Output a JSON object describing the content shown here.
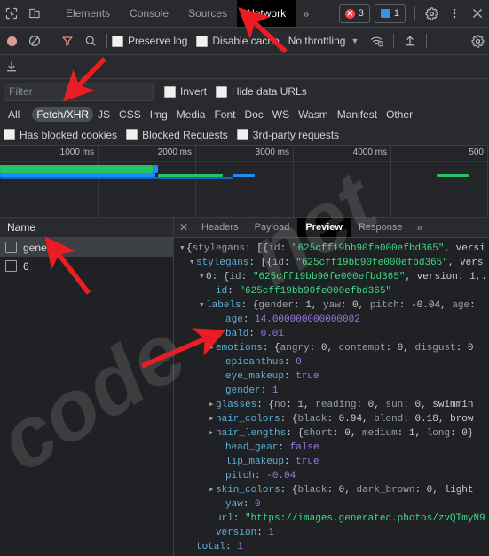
{
  "window": {
    "tabs": [
      {
        "label": "Elements",
        "active": false
      },
      {
        "label": "Console",
        "active": false
      },
      {
        "label": "Sources",
        "active": false
      },
      {
        "label": "Network",
        "active": true
      }
    ],
    "more_tabs_label": "»",
    "error_count": "3",
    "message_count": "1"
  },
  "toolbar": {
    "preserve_log": "Preserve log",
    "disable_cache": "Disable cache",
    "throttling": "No throttling",
    "throttle_caret": "▼"
  },
  "filter": {
    "placeholder": "Filter",
    "value": "",
    "invert": "Invert",
    "hide_data_urls": "Hide data URLs"
  },
  "types": [
    {
      "label": "All",
      "selected": false
    },
    {
      "label": "Fetch/XHR",
      "selected": true
    },
    {
      "label": "JS",
      "selected": false
    },
    {
      "label": "CSS",
      "selected": false
    },
    {
      "label": "Img",
      "selected": false
    },
    {
      "label": "Media",
      "selected": false
    },
    {
      "label": "Font",
      "selected": false
    },
    {
      "label": "Doc",
      "selected": false
    },
    {
      "label": "WS",
      "selected": false
    },
    {
      "label": "Wasm",
      "selected": false
    },
    {
      "label": "Manifest",
      "selected": false
    },
    {
      "label": "Other",
      "selected": false
    }
  ],
  "blocked": {
    "has_blocked_cookies": "Has blocked cookies",
    "blocked_requests": "Blocked Requests",
    "third_party": "3rd-party requests"
  },
  "overview": {
    "ticks": [
      "1000 ms",
      "2000 ms",
      "3000 ms",
      "4000 ms",
      "500"
    ],
    "colors": {
      "green": "#25c462",
      "blue": "#1a8cff",
      "darkblue": "#1565c0"
    }
  },
  "requests": {
    "column_header": "Name",
    "rows": [
      {
        "name": "generate",
        "selected": true
      },
      {
        "name": "6",
        "selected": false
      }
    ]
  },
  "detail": {
    "tabs": [
      {
        "label": "Headers",
        "active": false
      },
      {
        "label": "Payload",
        "active": false
      },
      {
        "label": "Preview",
        "active": true
      },
      {
        "label": "Response",
        "active": false
      }
    ],
    "more_label": "»",
    "close_label": "✕"
  },
  "preview": {
    "lines": [
      {
        "indent": 0,
        "arrow": "▾",
        "parts": [
          {
            "t": "{",
            "c": "p"
          },
          {
            "t": "stylegans",
            "c": "kd"
          },
          {
            "t": ": [{",
            "c": "p"
          },
          {
            "t": "id",
            "c": "kd"
          },
          {
            "t": ": ",
            "c": "p"
          },
          {
            "t": "\"625cff19bb90fe000efbd365\"",
            "c": "s"
          },
          {
            "t": ", versi",
            "c": "p"
          }
        ]
      },
      {
        "indent": 1,
        "arrow": "▾",
        "parts": [
          {
            "t": "stylegans",
            "c": "k"
          },
          {
            "t": ": [{",
            "c": "p"
          },
          {
            "t": "id",
            "c": "kd"
          },
          {
            "t": ": ",
            "c": "p"
          },
          {
            "t": "\"625cff19bb90fe000efbd365\"",
            "c": "s"
          },
          {
            "t": ", vers",
            "c": "p"
          }
        ]
      },
      {
        "indent": 2,
        "arrow": "▾",
        "parts": [
          {
            "t": "0",
            "c": "p"
          },
          {
            "t": ": {",
            "c": "p"
          },
          {
            "t": "id",
            "c": "kd"
          },
          {
            "t": ": ",
            "c": "p"
          },
          {
            "t": "\"625cff19bb90fe000efbd365\"",
            "c": "s"
          },
          {
            "t": ", version: 1,.",
            "c": "p"
          }
        ]
      },
      {
        "indent": 3,
        "arrow": "",
        "parts": [
          {
            "t": "id",
            "c": "k"
          },
          {
            "t": ": ",
            "c": "p"
          },
          {
            "t": "\"625cff19bb90fe000efbd365\"",
            "c": "s"
          }
        ]
      },
      {
        "indent": 2,
        "arrow": "▾",
        "parts": [
          {
            "t": "labels",
            "c": "k"
          },
          {
            "t": ": {",
            "c": "p"
          },
          {
            "t": "gender",
            "c": "kd"
          },
          {
            "t": ": 1, ",
            "c": "p"
          },
          {
            "t": "yaw",
            "c": "kd"
          },
          {
            "t": ": 0, ",
            "c": "p"
          },
          {
            "t": "pitch",
            "c": "kd"
          },
          {
            "t": ": -0.04, ",
            "c": "p"
          },
          {
            "t": "age",
            "c": "kd"
          },
          {
            "t": ":",
            "c": "p"
          }
        ]
      },
      {
        "indent": 4,
        "arrow": "",
        "parts": [
          {
            "t": "age",
            "c": "k"
          },
          {
            "t": ": ",
            "c": "p"
          },
          {
            "t": "14.000000000000002",
            "c": "n"
          }
        ]
      },
      {
        "indent": 4,
        "arrow": "",
        "parts": [
          {
            "t": "bald",
            "c": "k"
          },
          {
            "t": ": ",
            "c": "p"
          },
          {
            "t": "0.01",
            "c": "n"
          }
        ]
      },
      {
        "indent": 3,
        "arrow": "▸",
        "parts": [
          {
            "t": "emotions",
            "c": "k"
          },
          {
            "t": ": {",
            "c": "p"
          },
          {
            "t": "angry",
            "c": "kd"
          },
          {
            "t": ": 0, ",
            "c": "p"
          },
          {
            "t": "contempt",
            "c": "kd"
          },
          {
            "t": ": 0, ",
            "c": "p"
          },
          {
            "t": "disgust",
            "c": "kd"
          },
          {
            "t": ": 0",
            "c": "p"
          }
        ]
      },
      {
        "indent": 4,
        "arrow": "",
        "parts": [
          {
            "t": "epicanthus",
            "c": "k"
          },
          {
            "t": ": ",
            "c": "p"
          },
          {
            "t": "0",
            "c": "n"
          }
        ]
      },
      {
        "indent": 4,
        "arrow": "",
        "parts": [
          {
            "t": "eye_makeup",
            "c": "k"
          },
          {
            "t": ": ",
            "c": "p"
          },
          {
            "t": "true",
            "c": "b"
          }
        ]
      },
      {
        "indent": 4,
        "arrow": "",
        "parts": [
          {
            "t": "gender",
            "c": "k"
          },
          {
            "t": ": ",
            "c": "p"
          },
          {
            "t": "1",
            "c": "n"
          }
        ]
      },
      {
        "indent": 3,
        "arrow": "▸",
        "parts": [
          {
            "t": "glasses",
            "c": "k"
          },
          {
            "t": ": {",
            "c": "p"
          },
          {
            "t": "no",
            "c": "kd"
          },
          {
            "t": ": 1, ",
            "c": "p"
          },
          {
            "t": "reading",
            "c": "kd"
          },
          {
            "t": ": 0, ",
            "c": "p"
          },
          {
            "t": "sun",
            "c": "kd"
          },
          {
            "t": ": 0, swimmin",
            "c": "p"
          }
        ]
      },
      {
        "indent": 3,
        "arrow": "▸",
        "parts": [
          {
            "t": "hair_colors",
            "c": "k"
          },
          {
            "t": ": {",
            "c": "p"
          },
          {
            "t": "black",
            "c": "kd"
          },
          {
            "t": ": 0.94, ",
            "c": "p"
          },
          {
            "t": "blond",
            "c": "kd"
          },
          {
            "t": ": 0.18, brow",
            "c": "p"
          }
        ]
      },
      {
        "indent": 3,
        "arrow": "▸",
        "parts": [
          {
            "t": "hair_lengths",
            "c": "k"
          },
          {
            "t": ": {",
            "c": "p"
          },
          {
            "t": "short",
            "c": "kd"
          },
          {
            "t": ": 0, ",
            "c": "p"
          },
          {
            "t": "medium",
            "c": "kd"
          },
          {
            "t": ": 1, ",
            "c": "p"
          },
          {
            "t": "long",
            "c": "kd"
          },
          {
            "t": ": 0}",
            "c": "p"
          }
        ]
      },
      {
        "indent": 4,
        "arrow": "",
        "parts": [
          {
            "t": "head_gear",
            "c": "k"
          },
          {
            "t": ": ",
            "c": "p"
          },
          {
            "t": "false",
            "c": "b"
          }
        ]
      },
      {
        "indent": 4,
        "arrow": "",
        "parts": [
          {
            "t": "lip_makeup",
            "c": "k"
          },
          {
            "t": ": ",
            "c": "p"
          },
          {
            "t": "true",
            "c": "b"
          }
        ]
      },
      {
        "indent": 4,
        "arrow": "",
        "parts": [
          {
            "t": "pitch",
            "c": "k"
          },
          {
            "t": ": ",
            "c": "p"
          },
          {
            "t": "-0.04",
            "c": "n"
          }
        ]
      },
      {
        "indent": 3,
        "arrow": "▸",
        "parts": [
          {
            "t": "skin_colors",
            "c": "k"
          },
          {
            "t": ": {",
            "c": "p"
          },
          {
            "t": "black",
            "c": "kd"
          },
          {
            "t": ": 0, ",
            "c": "p"
          },
          {
            "t": "dark_brown",
            "c": "kd"
          },
          {
            "t": ": 0, light",
            "c": "p"
          }
        ]
      },
      {
        "indent": 4,
        "arrow": "",
        "parts": [
          {
            "t": "yaw",
            "c": "k"
          },
          {
            "t": ": ",
            "c": "p"
          },
          {
            "t": "0",
            "c": "n"
          }
        ]
      },
      {
        "indent": 3,
        "arrow": "",
        "parts": [
          {
            "t": "url",
            "c": "k"
          },
          {
            "t": ": ",
            "c": "p"
          },
          {
            "t": "\"https://images.generated.photos/zvQTmyN9",
            "c": "s"
          }
        ]
      },
      {
        "indent": 3,
        "arrow": "",
        "parts": [
          {
            "t": "version",
            "c": "k"
          },
          {
            "t": ": ",
            "c": "p"
          },
          {
            "t": "1",
            "c": "n"
          }
        ]
      },
      {
        "indent": 1,
        "arrow": "",
        "parts": [
          {
            "t": "total",
            "c": "k"
          },
          {
            "t": ": ",
            "c": "p"
          },
          {
            "t": "1",
            "c": "n"
          }
        ]
      }
    ]
  },
  "watermark": {
    "text_a": "code",
    "text_b": "net"
  }
}
